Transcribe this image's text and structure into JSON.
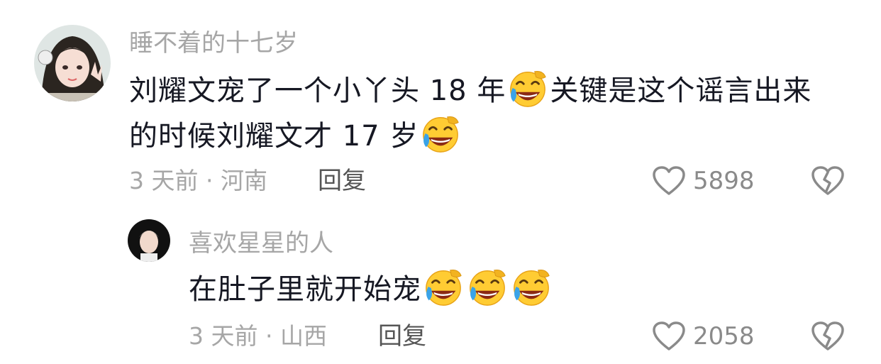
{
  "comments": [
    {
      "username": "睡不着的十七岁",
      "text_parts": [
        "刘耀文宠了一个小丫头 18 年",
        "关键是这个谣言出来的时候刘耀文才 17 岁"
      ],
      "emoji": "laughing-crying-emoji",
      "time": "3 天前",
      "location": "河南",
      "reply_label": "回复",
      "likes": "5898"
    },
    {
      "username": "喜欢星星的人",
      "text": "在肚子里就开始宠",
      "emoji": "laughing-crying-emoji",
      "emoji_count": 3,
      "time": "3 天前",
      "location": "山西",
      "reply_label": "回复",
      "likes": "2058"
    }
  ],
  "colors": {
    "username": "#a6a6a6",
    "text": "#161823",
    "meta": "#a6a6a6",
    "icon": "#8a8a8a"
  }
}
